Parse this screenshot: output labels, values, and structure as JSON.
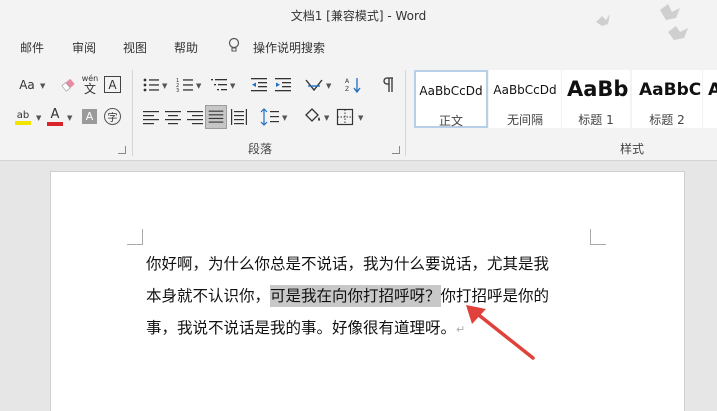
{
  "window": {
    "title": "文档1 [兼容模式]  -  Word"
  },
  "menu": {
    "items": [
      "邮件",
      "审阅",
      "视图",
      "帮助"
    ],
    "tell_me": "操作说明搜索"
  },
  "ribbon": {
    "font_group": {
      "change_case": "Aa",
      "phonetic_top": "wén",
      "phonetic_char": "文",
      "border_char": "A",
      "highlight_label": "ab",
      "font_color_label": "A",
      "shading_char": "A",
      "enclose_char": "字"
    },
    "paragraph_group": {
      "label": "段落"
    },
    "styles_group": {
      "label": "样式",
      "styles": [
        {
          "preview": "AaBbCcDd",
          "name": "正文",
          "active": true
        },
        {
          "preview": "AaBbCcDd",
          "name": "无间隔",
          "active": false
        },
        {
          "preview": "AaBb",
          "name": "标题 1",
          "active": false
        },
        {
          "preview": "AaBbC",
          "name": "标题 2",
          "active": false
        },
        {
          "preview": "A",
          "name": "",
          "active": false
        }
      ]
    }
  },
  "document": {
    "line1": "你好啊，为什么你总是不说话，我为什么要说话，尤其是我",
    "line2_before": "本身就不认识你，",
    "line2_selected": "可是我在向你打招呼呀？",
    "line2_after": "你打招呼是你的",
    "line3": "事，我说不说话是我的事。好像很有道理呀。",
    "paragraph_mark": "↵"
  },
  "colors": {
    "highlight": "#f0e400",
    "font_color": "#d8252a",
    "selection": "#c8c8c8",
    "arrow": "#e0413a"
  }
}
